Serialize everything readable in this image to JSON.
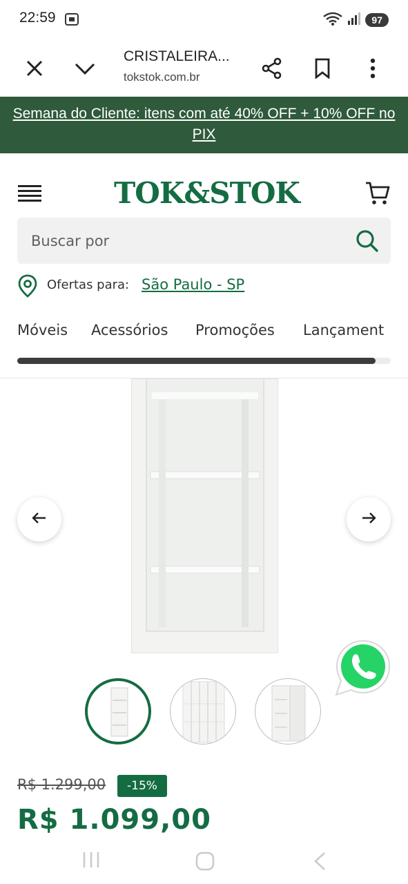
{
  "status_bar": {
    "time": "22:59",
    "battery": "97",
    "icons": [
      "screenshot-icon",
      "wifi-icon",
      "signal-icon",
      "battery-icon"
    ]
  },
  "browser": {
    "title": "CRISTALEIRA...",
    "domain": "tokstok.com.br",
    "icons": [
      "close-icon",
      "chevron-down-icon",
      "share-icon",
      "bookmark-icon",
      "more-vert-icon"
    ]
  },
  "promo": {
    "text": "Semana do Cliente: itens com até 40% OFF + 10% OFF no PIX"
  },
  "header": {
    "logo": "TOK&STOK",
    "brand_color": "#146c43"
  },
  "search": {
    "placeholder": "Buscar por"
  },
  "location": {
    "label": "Ofertas para:",
    "city": "São Paulo - SP"
  },
  "categories": [
    "Móveis",
    "Acessórios",
    "Promoções",
    "Lançament"
  ],
  "category_scroll": {
    "position": 0.96
  },
  "product": {
    "image_count": 3,
    "selected_image": 0,
    "old_price": "R$ 1.299,00",
    "discount": "-15%",
    "price": "R$ 1.099,00"
  },
  "colors": {
    "promo_bg": "#2f5a3c",
    "accent": "#146c43",
    "whatsapp": "#25d366"
  }
}
